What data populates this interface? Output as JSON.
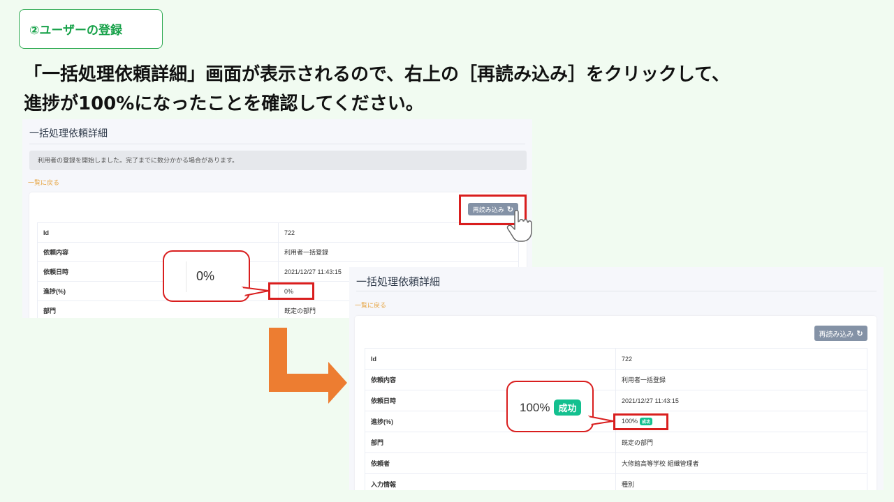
{
  "step_label": "②ユーザーの登録",
  "instruction": {
    "line1": "「一括処理依頼詳細」画面が表示されるので、右上の［再読み込み］をクリックして、",
    "line2": "進捗が100%になったことを確認してください。"
  },
  "before": {
    "page_title": "一括処理依頼詳細",
    "notice": "利用者の登録を開始しました。完了までに数分かかる場合があります。",
    "back_link": "一覧に戻る",
    "reload_label": "再読み込み",
    "rows": [
      {
        "label": "Id",
        "value": "722"
      },
      {
        "label": "依頼内容",
        "value": "利用者一括登録"
      },
      {
        "label": "依頼日時",
        "value": "2021/12/27 11:43:15"
      },
      {
        "label": "進捗(%)",
        "value": "0%"
      },
      {
        "label": "部門",
        "value": "既定の部門"
      }
    ],
    "callout": "0%"
  },
  "after": {
    "page_title": "一括処理依頼詳細",
    "back_link": "一覧に戻る",
    "reload_label": "再読み込み",
    "rows": [
      {
        "label": "Id",
        "value": "722"
      },
      {
        "label": "依頼内容",
        "value": "利用者一括登録"
      },
      {
        "label": "依頼日時",
        "value": "2021/12/27 11:43:15"
      },
      {
        "label": "進捗(%)",
        "value": "100%",
        "tag": "成功"
      },
      {
        "label": "部門",
        "value": "既定の部門"
      },
      {
        "label": "依頼者",
        "value": "大修館高等学校 組織管理者"
      },
      {
        "label": "入力情報",
        "value": "種別"
      }
    ],
    "callout_value": "100%",
    "callout_tag": "成功"
  },
  "colors": {
    "highlight": "#d91e1e",
    "arrow": "#ed7d31",
    "success_tag": "#13c08f",
    "step_green": "#18a24a"
  }
}
